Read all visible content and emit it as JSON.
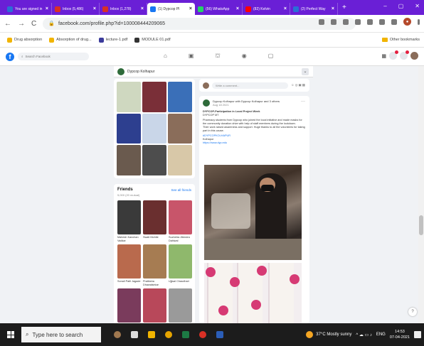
{
  "tabs": [
    {
      "label": "You are signed in",
      "color": "#2a6fd6"
    },
    {
      "label": "Inbox (5,486)",
      "color": "#d93025"
    },
    {
      "label": "Inbox (1,278)",
      "color": "#d93025"
    },
    {
      "label": "(1) Dypcop Pl",
      "color": "#1877f2",
      "active": true
    },
    {
      "label": "(56) WhatsApp",
      "color": "#25d366"
    },
    {
      "label": "(82) Kelvin",
      "color": "#ff0000"
    },
    {
      "label": "(2) Perfect Way",
      "color": "#2a6fd6"
    }
  ],
  "newtab": "+",
  "address": {
    "url": "facebook.com/profile.php?id=100008444209065"
  },
  "bookmarks": {
    "items": [
      {
        "label": "Drug absorption",
        "color": "#f1b400"
      },
      {
        "label": "Absorption of drug...",
        "color": "#f1b400"
      },
      {
        "label": "lecture-1.pdf",
        "color": "#3b3b9b"
      },
      {
        "label": "MODULE 01.pdf",
        "color": "#333333"
      }
    ],
    "other": "Other bookmarks"
  },
  "fb": {
    "logo": "f",
    "search_placeholder": "Search Facebook"
  },
  "profile": {
    "name": "Dypcop Kolhapur"
  },
  "compose": {
    "placeholder": "Write a comment..."
  },
  "friends": {
    "title": "Friends",
    "see_all": "See all friends",
    "count": "5,000 (20 mutual)",
    "list": [
      {
        "name": "Mahesh Kanchan Vadkar",
        "color": "#3a3a3a"
      },
      {
        "name": "Swati Mohite",
        "color": "#6a2f2f"
      },
      {
        "name": "Suchetra Jitendra Dahiwal",
        "color": "#c8556a"
      },
      {
        "name": "Sonali Patil Jagade",
        "color": "#b96a4d"
      },
      {
        "name": "Pratiksha Dhawalsekar",
        "color": "#a67c52"
      },
      {
        "name": "Ujjwal Chaudhari",
        "color": "#8fb86c"
      },
      {
        "name": "",
        "color": "#7a3b5c"
      },
      {
        "name": "",
        "color": "#b8485a"
      },
      {
        "name": "",
        "color": "#9a9a9a"
      }
    ]
  },
  "post": {
    "author": "Dypcop Kolhapur with Dypcop Kolhapur and 3 others",
    "time": "Aug 18 2021",
    "title": "DYPCOP-Participation in Local Project Week",
    "subtitle": "DYPCOP MT",
    "text": "Pharmacy students from Dypcop who joined the local initiative and made masks for the community donation drive with help of staff members during the lockdown.",
    "text2": "Their work raised awareness and support. Huge thanks to all the volunteers for taking part in this cause.",
    "link": "#DYPCOPKOLHAPUR",
    "sign1": "Kolhapur",
    "sign2": "https://www.dyp.edu"
  },
  "taskbar": {
    "search_placeholder": "Type here to search",
    "weather": "37°C  Mostly sunny",
    "lang": "ENG",
    "time": "14:53",
    "date": "07-04-2021"
  }
}
